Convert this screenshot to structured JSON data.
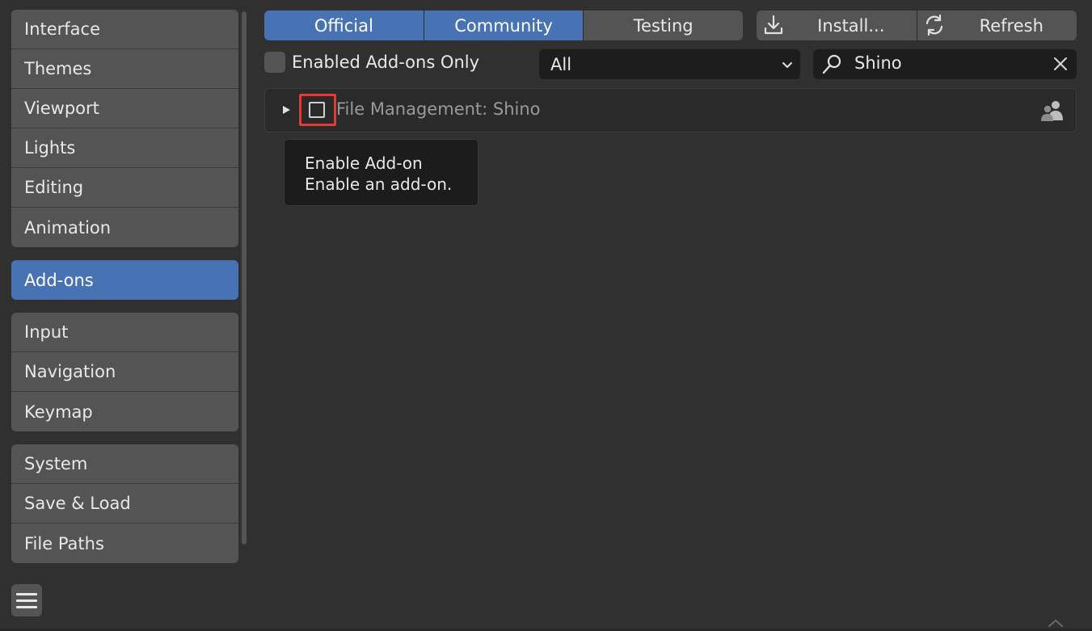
{
  "sidebar": {
    "groups": [
      [
        "Interface",
        "Themes",
        "Viewport",
        "Lights",
        "Editing",
        "Animation"
      ],
      [
        "Add-ons"
      ],
      [
        "Input",
        "Navigation",
        "Keymap"
      ],
      [
        "System",
        "Save & Load",
        "File Paths"
      ]
    ],
    "active": "Add-ons",
    "menu_icon": "hamburger-menu-icon"
  },
  "tabs": [
    {
      "label": "Official",
      "on": true
    },
    {
      "label": "Community",
      "on": true
    },
    {
      "label": "Testing",
      "on": false
    }
  ],
  "actions": {
    "install_label": "Install...",
    "install_icon": "download-icon",
    "refresh_label": "Refresh",
    "refresh_icon": "refresh-icon"
  },
  "filters": {
    "enabled_only_label": "Enabled Add-ons Only",
    "category_value": "All",
    "search_value": "Shino"
  },
  "addon": {
    "name": "File Management: Shino",
    "enabled": false,
    "support_icon": "community-icon"
  },
  "tooltip": {
    "title": "Enable Add-on",
    "description": "Enable an add-on."
  },
  "colors": {
    "accent": "#4772b3",
    "highlight_frame": "#e53935"
  }
}
